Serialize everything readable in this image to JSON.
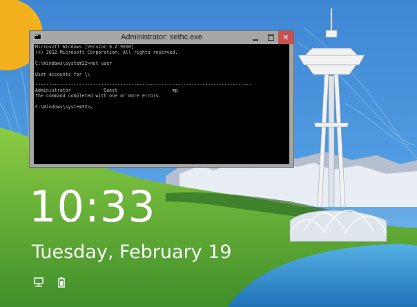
{
  "window": {
    "title": "Administrator: sethc.exe",
    "buttons": {
      "minimize": "minimize",
      "maximize": "maximize",
      "close": "close"
    }
  },
  "console": {
    "lines": [
      "Microsoft Windows [Version 6.2.9200]",
      "(c) 2012 Microsoft Corporation. All rights reserved.",
      "",
      "C:\\Windows\\system32>net user",
      "",
      "User accounts for \\\\",
      "",
      "-------------------------------------------------------------------------------",
      "Administrator            Guest                    mp",
      "The command completed with one or more errors.",
      "",
      "C:\\Windows\\system32>"
    ]
  },
  "lockscreen": {
    "time": "10:33",
    "date": "Tuesday, February 19"
  },
  "icons": {
    "network": "network-icon",
    "battery": "battery-icon"
  },
  "colors": {
    "sky": "#4a8fd6",
    "sun": "#f3b21d",
    "grass": "#6fb53a",
    "water": "#2f90cf",
    "console_bg": "#000000",
    "console_text": "#c0c0c0",
    "close_button": "#c75050"
  }
}
